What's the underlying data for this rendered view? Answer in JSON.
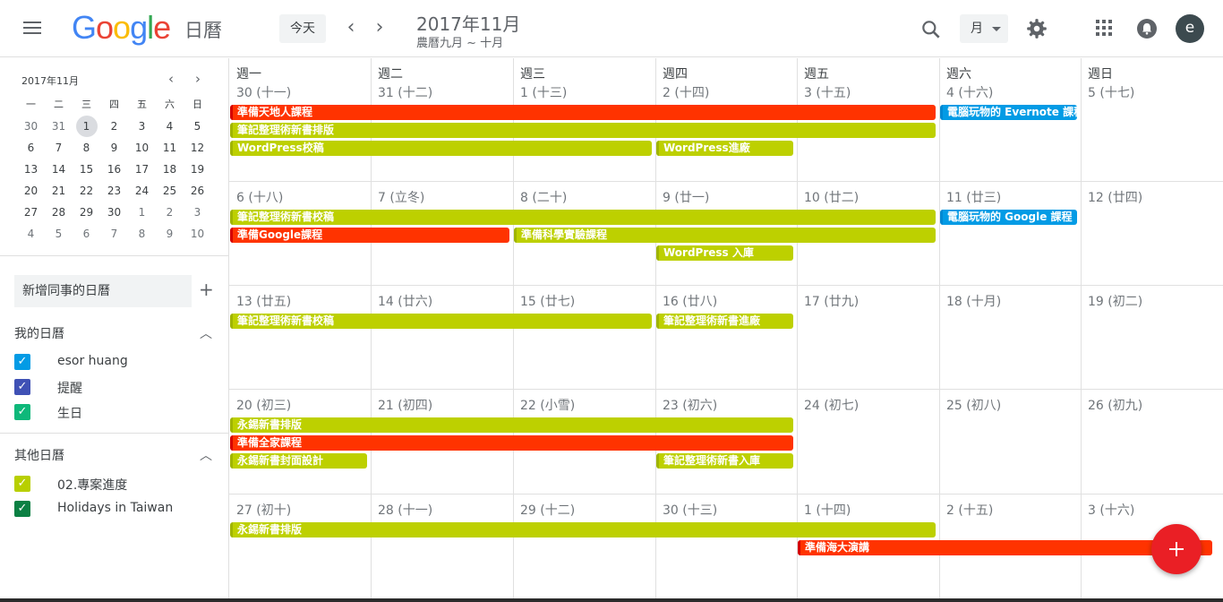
{
  "header": {
    "app_name": "日曆",
    "today_label": "今天",
    "month_title": "2017年11月",
    "lunar_subtitle": "農曆九月 ~ 十月",
    "view_label": "月",
    "avatar_letter": "e"
  },
  "mini_calendar": {
    "title": "2017年11月",
    "weekday_headers": [
      "一",
      "二",
      "三",
      "四",
      "五",
      "六",
      "日"
    ],
    "weeks": [
      [
        "30",
        "31",
        "1",
        "2",
        "3",
        "4",
        "5"
      ],
      [
        "6",
        "7",
        "8",
        "9",
        "10",
        "11",
        "12"
      ],
      [
        "13",
        "14",
        "15",
        "16",
        "17",
        "18",
        "19"
      ],
      [
        "20",
        "21",
        "22",
        "23",
        "24",
        "25",
        "26"
      ],
      [
        "27",
        "28",
        "29",
        "30",
        "1",
        "2",
        "3"
      ],
      [
        "4",
        "5",
        "6",
        "7",
        "8",
        "9",
        "10"
      ]
    ]
  },
  "sidebar": {
    "add_calendar_placeholder": "新增同事的日曆",
    "my_calendars_title": "我的日曆",
    "my_calendars": [
      {
        "label": "esor huang",
        "color": "#039be5"
      },
      {
        "label": "提醒",
        "color": "#3f51b5"
      },
      {
        "label": "生日",
        "color": "#0eb87a"
      }
    ],
    "other_calendars_title": "其他日曆",
    "other_calendars": [
      {
        "label": "02.專案進度",
        "color": "#b8cf00"
      },
      {
        "label": "Holidays in Taiwan",
        "color": "#0b8043"
      }
    ]
  },
  "month_grid": {
    "weekdays": [
      "週一",
      "週二",
      "週三",
      "週四",
      "週五",
      "週六",
      "週日"
    ],
    "weeks": [
      [
        "30 (十一)",
        "31 (十二)",
        "1 (十三)",
        "2 (十四)",
        "3 (十五)",
        "4 (十六)",
        "5 (十七)"
      ],
      [
        "6 (十八)",
        "7 (立冬)",
        "8 (二十)",
        "9 (廿一)",
        "10 (廿二)",
        "11 (廿三)",
        "12 (廿四)"
      ],
      [
        "13 (廿五)",
        "14 (廿六)",
        "15 (廿七)",
        "16 (廿八)",
        "17 (廿九)",
        "18 (十月)",
        "19 (初二)"
      ],
      [
        "20 (初三)",
        "21 (初四)",
        "22 (小雪)",
        "23 (初六)",
        "24 (初七)",
        "25 (初八)",
        "26 (初九)"
      ],
      [
        "27 (初十)",
        "28 (十一)",
        "29 (十二)",
        "30 (十三)",
        "1 (十四)",
        "2 (十五)",
        "3 (十六)"
      ]
    ]
  },
  "colors": {
    "red": "#ff3300",
    "green": "#bdd000",
    "blue": "#039be5"
  },
  "events": [
    {
      "title": "準備天地人課程",
      "week": 0,
      "start": 0,
      "end": 4,
      "row": 0,
      "color": "red"
    },
    {
      "title": "電腦玩物的 Evernote 課程",
      "week": 0,
      "start": 5,
      "end": 5,
      "row": 0,
      "color": "blue"
    },
    {
      "title": "筆記整理術新書排版",
      "week": 0,
      "start": 0,
      "end": 4,
      "row": 1,
      "color": "green"
    },
    {
      "title": "WordPress校稿",
      "week": 0,
      "start": 0,
      "end": 2,
      "row": 2,
      "color": "green"
    },
    {
      "title": "WordPress進廠",
      "week": 0,
      "start": 3,
      "end": 3,
      "row": 2,
      "color": "green"
    },
    {
      "title": "筆記整理術新書校稿",
      "week": 1,
      "start": 0,
      "end": 4,
      "row": 0,
      "color": "green"
    },
    {
      "title": "電腦玩物的 Google 課程",
      "week": 1,
      "start": 5,
      "end": 5,
      "row": 0,
      "color": "blue"
    },
    {
      "title": "準備Google課程",
      "week": 1,
      "start": 0,
      "end": 1,
      "row": 1,
      "color": "red"
    },
    {
      "title": "準備科學實驗課程",
      "week": 1,
      "start": 2,
      "end": 4,
      "row": 1,
      "color": "green"
    },
    {
      "title": "WordPress 入庫",
      "week": 1,
      "start": 3,
      "end": 3,
      "row": 2,
      "color": "green"
    },
    {
      "title": "筆記整理術新書校稿",
      "week": 2,
      "start": 0,
      "end": 2,
      "row": 0,
      "color": "green"
    },
    {
      "title": "筆記整理術新書進廠",
      "week": 2,
      "start": 3,
      "end": 3,
      "row": 0,
      "color": "green"
    },
    {
      "title": "永錫新書排版",
      "week": 3,
      "start": 0,
      "end": 3,
      "row": 0,
      "color": "green"
    },
    {
      "title": "準備全家課程",
      "week": 3,
      "start": 0,
      "end": 3,
      "row": 1,
      "color": "red"
    },
    {
      "title": "永錫新書封面設計",
      "week": 3,
      "start": 0,
      "end": 0,
      "row": 2,
      "color": "green"
    },
    {
      "title": "筆記整理術新書入庫",
      "week": 3,
      "start": 3,
      "end": 3,
      "row": 2,
      "color": "green"
    },
    {
      "title": "永錫新書排版",
      "week": 4,
      "start": 0,
      "end": 4,
      "row": 0,
      "color": "green"
    },
    {
      "title": "準備海大演講",
      "week": 4,
      "start": 4,
      "end": 6,
      "row": 1,
      "color": "red"
    }
  ]
}
